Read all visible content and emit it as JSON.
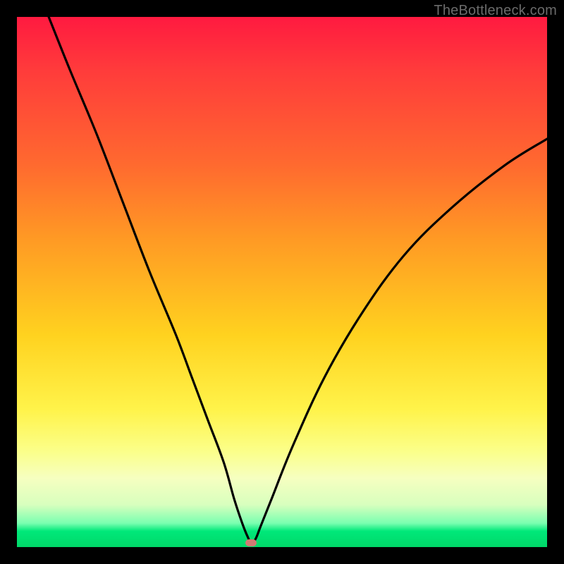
{
  "watermark": "TheBottleneck.com",
  "chart_data": {
    "type": "line",
    "title": "",
    "xlabel": "",
    "ylabel": "",
    "xlim": [
      0,
      100
    ],
    "ylim": [
      0,
      100
    ],
    "grid": false,
    "legend": false,
    "series": [
      {
        "name": "bottleneck-curve",
        "x": [
          6,
          10,
          15,
          20,
          25,
          30,
          33,
          36,
          39,
          41,
          42.5,
          43.5,
          44.2,
          45,
          46,
          48,
          52,
          58,
          65,
          73,
          82,
          92,
          100
        ],
        "y": [
          100,
          90,
          78,
          65,
          52,
          40,
          32,
          24,
          16,
          9,
          4.5,
          2,
          0.8,
          1.5,
          4,
          9,
          19,
          32,
          44,
          55,
          64,
          72,
          77
        ]
      }
    ],
    "marker": {
      "x": 44.2,
      "y": 0.8,
      "color": "#d17a73"
    },
    "background_gradient": {
      "top": "#ff1a40",
      "mid": "#ffd21f",
      "bottom": "#00d868"
    }
  }
}
